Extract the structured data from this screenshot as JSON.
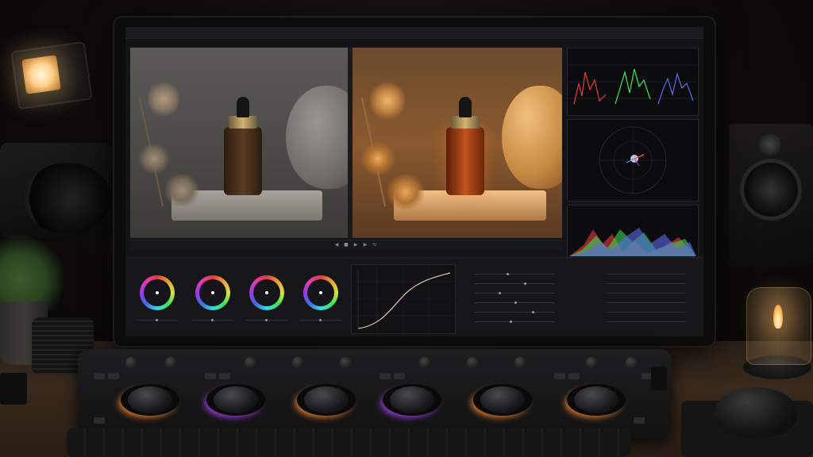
{
  "app": {
    "title": "",
    "panels": {
      "scopes_label": "",
      "curves_label": "",
      "wheels": [
        {
          "label": ""
        },
        {
          "label": ""
        },
        {
          "label": ""
        },
        {
          "label": ""
        }
      ]
    }
  },
  "colors": {
    "accent_orange": "#e07a2a",
    "accent_purple": "#a23be2",
    "ui_bg": "#141416"
  },
  "icons": [
    "play-icon",
    "stop-icon",
    "rewind-icon",
    "forward-icon",
    "loop-icon"
  ]
}
